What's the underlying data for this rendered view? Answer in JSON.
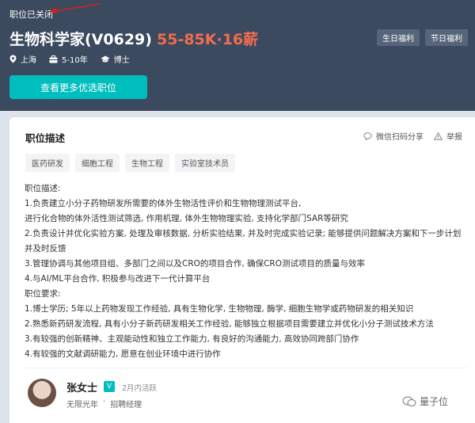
{
  "header": {
    "status": "职位已关闭",
    "title": "生物科学家(V0629)",
    "salary": "55-85K·16薪",
    "benefits": [
      "生日福利",
      "节日福利"
    ],
    "meta": {
      "location": "上海",
      "experience": "5-10年",
      "degree": "博士"
    },
    "cta_label": "查看更多优选职位"
  },
  "card": {
    "section_title": "职位描述",
    "share_label": "微信扫码分享",
    "report_label": "举报",
    "tags": [
      "医药研发",
      "细胞工程",
      "生物工程",
      "实验室技术员"
    ],
    "description": [
      "职位描述:",
      " 1.负责建立小分子药物研发所需要的体外生物活性评价和生物物理测试平台,",
      "进行化合物的体外活性测试筛选, 作用机理, 体外生物物理实验, 支持化学部门SAR等研究",
      " 2.负责设计并优化实验方案, 处理及审核数据, 分析实验结果, 并及时完成实验记录; 能够提供问题解决方案和下一步计划",
      "并及时反馈",
      "3.管理协调与其他项目组、多部门之间以及CRO的项目合作, 确保CRO测试项目的质量与效率",
      "4.与AI/ML平台合作, 积极参与改进下一代计算平台",
      "职位要求:",
      "1.博士学历; 5年以上药物发现工作经验, 具有生物化学, 生物物理, 酶学, 细胞生物学或药物研发的相关知识",
      " 2.熟悉新药研发流程, 具有小分子新药研发相关工作经验, 能够独立根据项目需要建立并优化小分子测试技术方法",
      " 3.有较强的创新精神、主观能动性和独立工作能力, 有良好的沟通能力, 高效协同跨部门协作",
      " 4.有较强的文献调研能力, 愿意在创业环境中进行协作"
    ]
  },
  "recruiter": {
    "name": "张女士",
    "verified_badge": "V",
    "active": "2月内活跃",
    "company": "无限光年",
    "separator": "·",
    "role": "招聘经理"
  },
  "watermark": "量子位",
  "colors": {
    "header_bg": "#3b4a5e",
    "salary": "#f26d4f",
    "accent": "#00bebd"
  }
}
